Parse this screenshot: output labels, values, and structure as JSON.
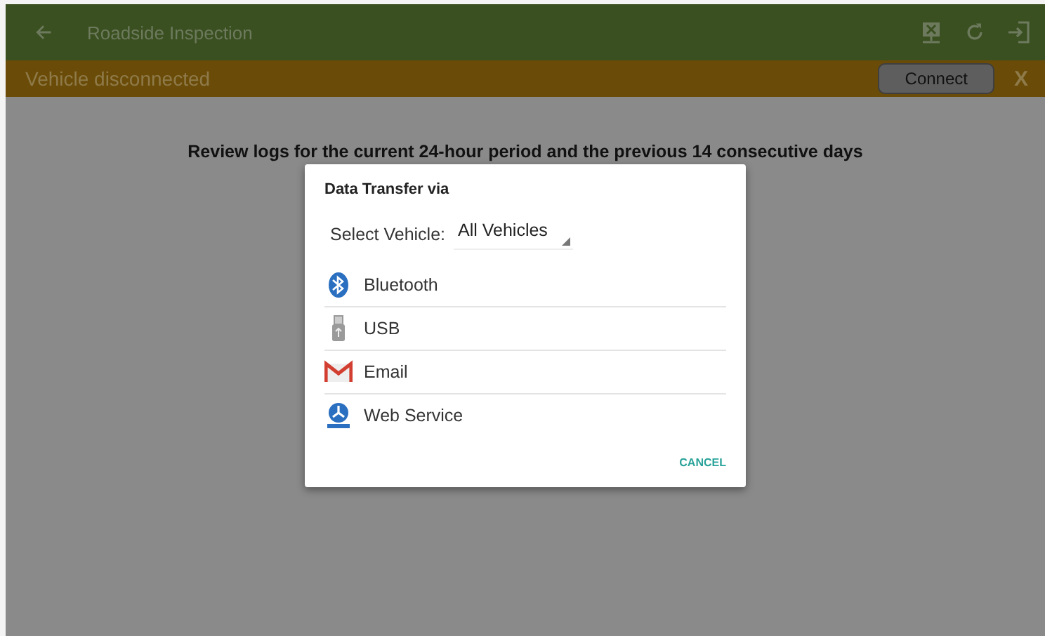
{
  "app_bar": {
    "title": "Roadside Inspection"
  },
  "status_banner": {
    "message": "Vehicle disconnected",
    "button": "Connect",
    "close": "X"
  },
  "content": {
    "heading": "Review logs for the current 24-hour period and the previous 14 consecutive days"
  },
  "dialog": {
    "title": "Data Transfer via",
    "vehicle_label": "Select Vehicle:",
    "vehicle_value": "All Vehicles",
    "options": [
      {
        "kind": "bluetooth",
        "label": "Bluetooth"
      },
      {
        "kind": "usb",
        "label": "USB"
      },
      {
        "kind": "email",
        "label": "Email"
      },
      {
        "kind": "web",
        "label": "Web Service"
      }
    ],
    "cancel": "CANCEL"
  }
}
